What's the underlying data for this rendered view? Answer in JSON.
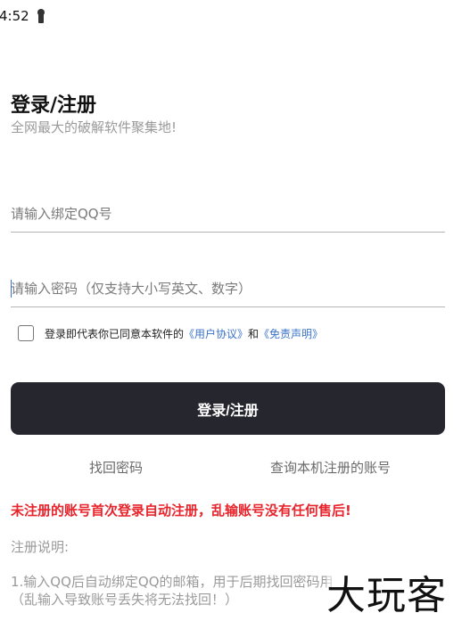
{
  "status_bar": {
    "time": "4:52",
    "icon": "keyhole-icon"
  },
  "header": {
    "title": "登录/注册",
    "subtitle": "全网最大的破解软件聚集地!"
  },
  "form": {
    "qq_placeholder": "请输入绑定QQ号",
    "password_placeholder": "请输入密码（仅支持大小写英文、数字）"
  },
  "agreement": {
    "prefix": "登录即代表你已同意本软件的",
    "user_agreement": "《用户协议》",
    "and": "和",
    "disclaimer": "《免责声明》"
  },
  "login_button": "登录/注册",
  "links": {
    "find_password": "找回密码",
    "query_account": "查询本机注册的账号"
  },
  "warning": "未注册的账号首次登录自动注册，乱输账号没有任何售后!",
  "notes": {
    "title": "注册说明:",
    "line1": "1.输入QQ后自动绑定QQ的邮箱，用于后期找回密码用",
    "line2": "（乱输入导致账号丢失将无法找回！）"
  },
  "watermark": "大玩客",
  "colors": {
    "button_bg": "#26262e",
    "link": "#3b73c8",
    "warning": "#e8242c",
    "muted": "#9a9a9a"
  }
}
